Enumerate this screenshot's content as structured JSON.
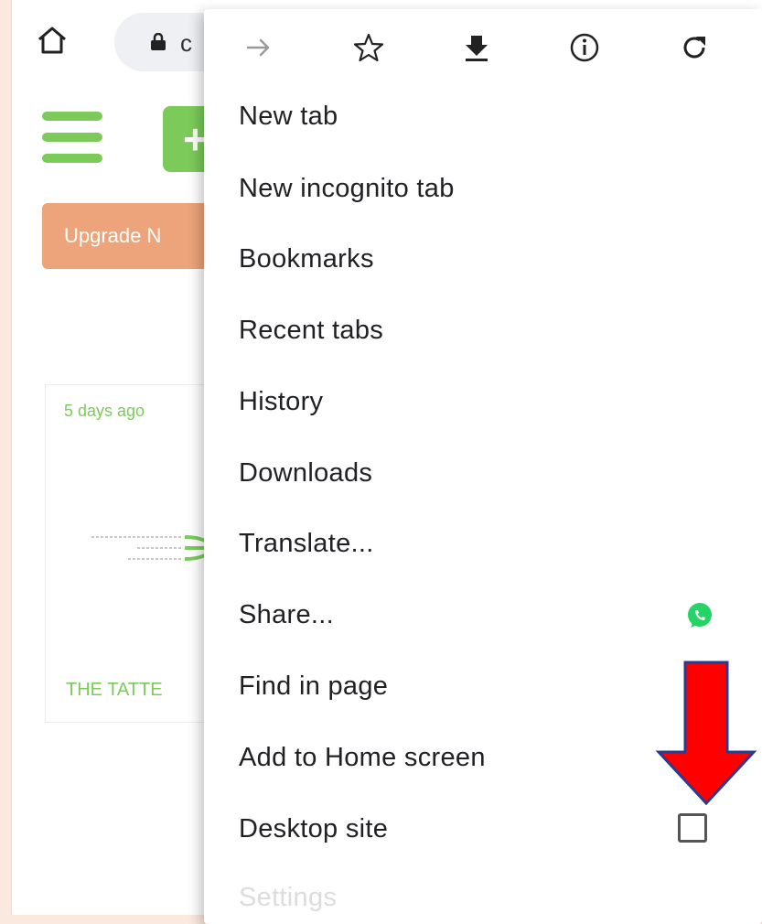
{
  "toolbar": {
    "url_text": "c",
    "icons": [
      "home-icon",
      "lock-icon",
      "forward-icon",
      "star-icon",
      "download-icon",
      "info-icon",
      "refresh-icon"
    ]
  },
  "page": {
    "upgrade_label": "Upgrade N",
    "add_label": "+",
    "card": {
      "date": "5 days ago",
      "title": "THE TATTE"
    }
  },
  "menu": {
    "items": [
      {
        "label": "New tab"
      },
      {
        "label": "New incognito tab"
      },
      {
        "label": "Bookmarks"
      },
      {
        "label": "Recent tabs"
      },
      {
        "label": "History"
      },
      {
        "label": "Downloads"
      },
      {
        "label": "Translate..."
      },
      {
        "label": "Share..."
      },
      {
        "label": "Find in page"
      },
      {
        "label": "Add to Home screen"
      },
      {
        "label": "Desktop site"
      },
      {
        "label": "Settings"
      }
    ],
    "desktop_site_checked": false
  },
  "colors": {
    "accent_green": "#7ccb5a",
    "upgrade_orange": "#eda47a",
    "annotation_red": "#ff0000",
    "annotation_blue": "#2b3a8f",
    "whatsapp_green": "#25d366"
  }
}
